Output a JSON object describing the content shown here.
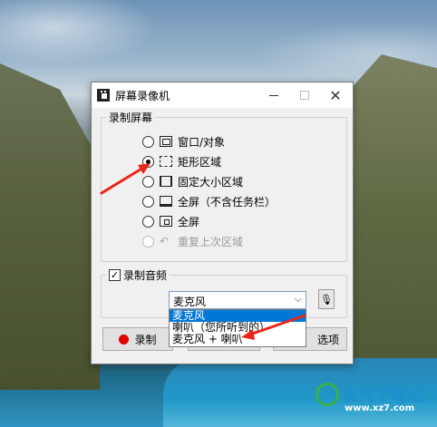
{
  "window": {
    "title": "屏幕录像机"
  },
  "screen_group": {
    "label": "录制屏幕",
    "options": [
      {
        "label": "窗口/对象",
        "icon": "window-icon",
        "selected": false,
        "enabled": true
      },
      {
        "label": "矩形区域",
        "icon": "rectangle-dashed-icon",
        "selected": true,
        "enabled": true
      },
      {
        "label": "固定大小区域",
        "icon": "fixed-size-icon",
        "selected": false,
        "enabled": true
      },
      {
        "label": "全屏（不含任务栏）",
        "icon": "fullscreen-taskbar-icon",
        "selected": false,
        "enabled": true
      },
      {
        "label": "全屏",
        "icon": "fullscreen-icon",
        "selected": false,
        "enabled": true
      },
      {
        "label": "重复上次区域",
        "icon": "repeat-icon",
        "selected": false,
        "enabled": false
      }
    ]
  },
  "audio_group": {
    "label": "录制音频",
    "checked": true,
    "selected_source": "麦克风",
    "dropdown_items": [
      "麦克风",
      "喇叭（您所听到的）",
      "麦克风 + 喇叭"
    ],
    "highlighted_item": 0
  },
  "buttons": {
    "record": "录制",
    "options": "选项"
  },
  "watermark": {
    "text": "极光下载站",
    "url": "www.xz7.com"
  },
  "colors": {
    "selection": "#0078d7",
    "record_dot": "#e00000",
    "annotation": "#e8261b"
  }
}
